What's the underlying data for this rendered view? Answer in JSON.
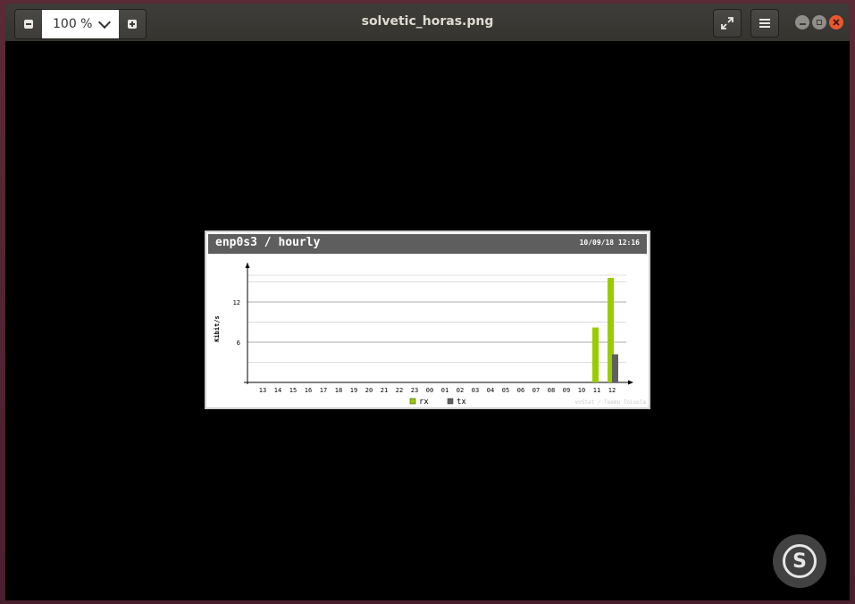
{
  "window": {
    "title": "solvetic_horas.png",
    "zoom_value": "100 %"
  },
  "icons": {
    "zoom_out": "minus-icon",
    "zoom_in": "plus-icon",
    "zoom_dropdown": "chevron-down-icon",
    "fullscreen": "fullscreen-icon",
    "menu": "hamburger-menu-icon",
    "minimize": "minimize-icon",
    "maximize": "maximize-icon",
    "close": "close-icon"
  },
  "image": {
    "header_title": "enp0s3 / hourly",
    "header_date": "10/09/18 12:16",
    "credit": "vnStat / Teemu Toivola"
  },
  "chart_data": {
    "type": "bar",
    "ylabel": "Kibit/s",
    "xlabel": "",
    "ylim": [
      0,
      16
    ],
    "yticks": [
      6,
      12
    ],
    "grid": true,
    "categories": [
      "13",
      "14",
      "15",
      "16",
      "17",
      "18",
      "19",
      "20",
      "21",
      "22",
      "23",
      "00",
      "01",
      "02",
      "03",
      "04",
      "05",
      "06",
      "07",
      "08",
      "09",
      "10",
      "11",
      "12"
    ],
    "series": [
      {
        "name": "rx",
        "color": "#99cc00",
        "values": [
          0,
          0,
          0,
          0,
          0,
          0,
          0,
          0,
          0,
          0,
          0,
          0,
          0,
          0,
          0,
          0,
          0,
          0,
          0,
          0,
          0,
          0,
          8.2,
          15.6
        ]
      },
      {
        "name": "tx",
        "color": "#606060",
        "values": [
          0,
          0,
          0,
          0,
          0,
          0,
          0,
          0,
          0,
          0,
          0,
          0,
          0,
          0,
          0,
          0,
          0,
          0,
          0,
          0,
          0,
          0,
          0,
          4.2
        ]
      }
    ],
    "legend": "bottom-center"
  },
  "colors": {
    "headerbar": "#3c3b37",
    "close": "#e9572f",
    "rx": "#99cc00",
    "tx": "#606060",
    "chart_header": "#5e5e5e"
  }
}
